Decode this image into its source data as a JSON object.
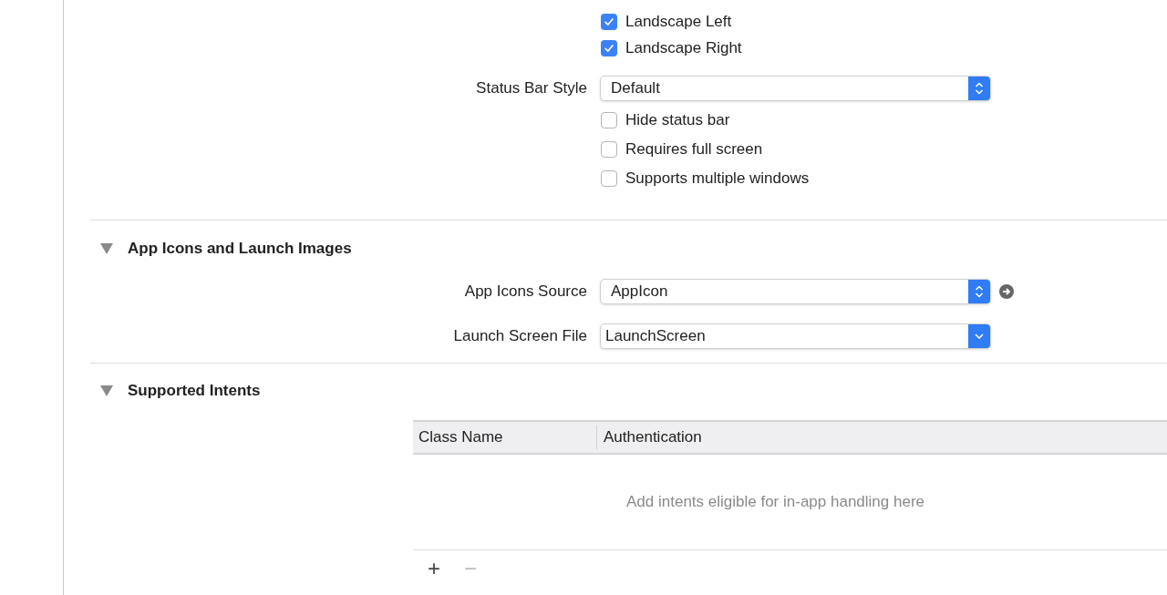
{
  "orientation_checkboxes": [
    {
      "label": "Landscape Left",
      "checked": true
    },
    {
      "label": "Landscape Right",
      "checked": true
    }
  ],
  "status_bar_style": {
    "label": "Status Bar Style",
    "value": "Default"
  },
  "status_bar_options": [
    {
      "label": "Hide status bar",
      "checked": false
    },
    {
      "label": "Requires full screen",
      "checked": false
    },
    {
      "label": "Supports multiple windows",
      "checked": false
    }
  ],
  "app_icons_section": {
    "title": "App Icons and Launch Images",
    "expanded": true,
    "fields": [
      {
        "kind": "popup",
        "label": "App Icons Source",
        "value": "AppIcon",
        "has_go_arrow": true
      },
      {
        "kind": "combo",
        "label": "Launch Screen File",
        "value": "LaunchScreen",
        "has_go_arrow": false
      }
    ]
  },
  "intents_section": {
    "title": "Supported Intents",
    "expanded": true,
    "table": {
      "columns": [
        "Class Name",
        "Authentication"
      ],
      "empty_message": "Add intents eligible for in-app handling here"
    },
    "buttons": [
      "+",
      "−"
    ]
  }
}
